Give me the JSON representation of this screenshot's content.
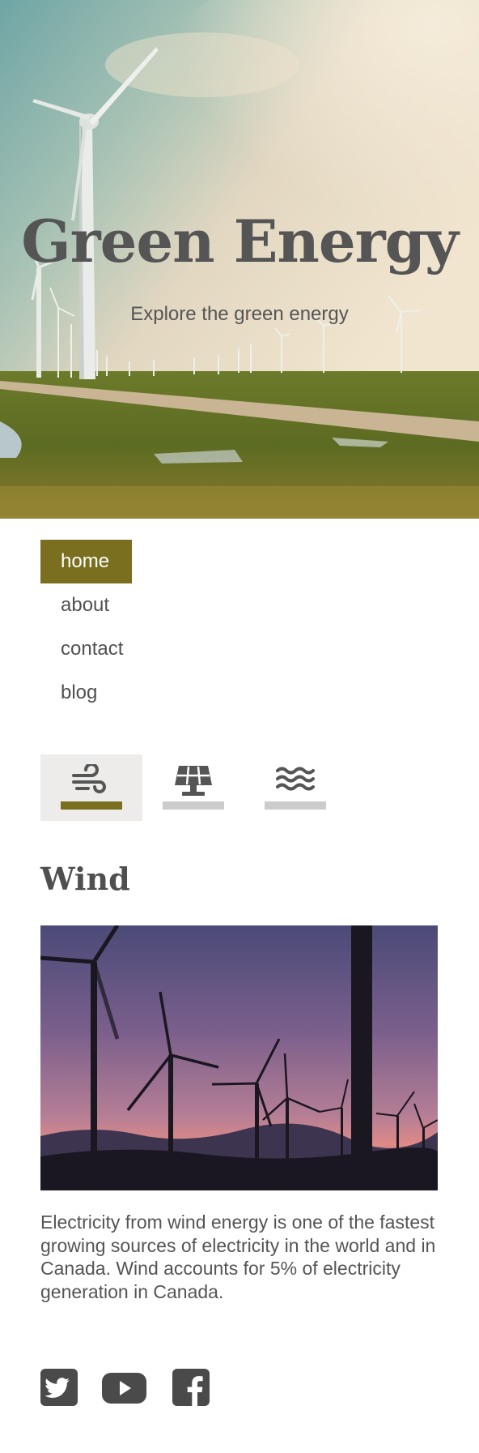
{
  "hero": {
    "title": "Green Energy",
    "subtitle": "Explore the green energy"
  },
  "nav": {
    "items": [
      {
        "label": "home",
        "active": true
      },
      {
        "label": "about",
        "active": false
      },
      {
        "label": "contact",
        "active": false
      },
      {
        "label": "blog",
        "active": false
      }
    ]
  },
  "tabs": [
    {
      "icon": "wind-icon",
      "active": true
    },
    {
      "icon": "solar-panel-icon",
      "active": false
    },
    {
      "icon": "water-waves-icon",
      "active": false
    }
  ],
  "section": {
    "title": "Wind",
    "description": "Electricity from wind energy is one of the fastest growing sources of electricity in the world and in Canada. Wind accounts for 5% of electricity generation in Canada."
  },
  "social": [
    {
      "icon": "twitter-icon"
    },
    {
      "icon": "youtube-icon"
    },
    {
      "icon": "facebook-icon"
    }
  ],
  "colors": {
    "accent": "#7a6e1f",
    "text": "#555555",
    "tab_active_bg": "#eeeceb",
    "tab_inactive_bar": "#cccccc"
  }
}
